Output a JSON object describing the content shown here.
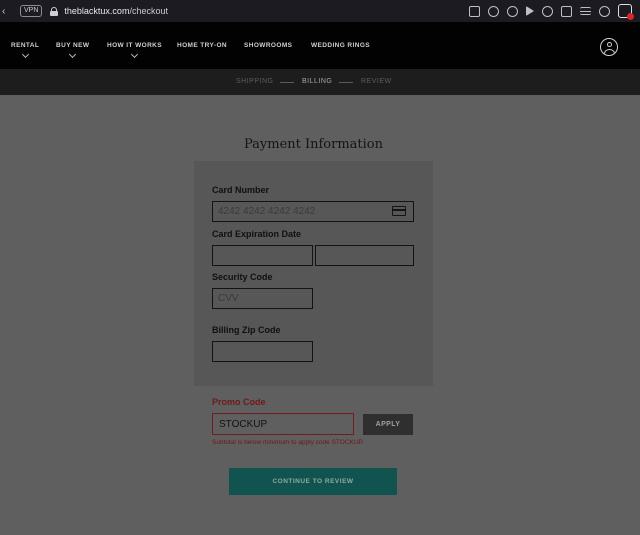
{
  "browser": {
    "back_icon": "chevron-left-icon",
    "vpn_label": "VPN",
    "url_host": "theblacktux.com",
    "url_path": "/checkout"
  },
  "nav": {
    "items": [
      "RENTAL",
      "BUY NEW",
      "HOW IT WORKS",
      "HOME TRY-ON",
      "SHOWROOMS",
      "WEDDING RINGS"
    ],
    "account_icon": "account-icon"
  },
  "steps": {
    "shipping": "SHIPPING",
    "billing": "BILLING",
    "review": "REVIEW",
    "active": "BILLING"
  },
  "form": {
    "title": "Payment Information",
    "card_number_label": "Card Number",
    "card_number_placeholder": "4242 4242 4242 4242",
    "expiration_label": "Card Expiration Date",
    "expiration_month_value": "",
    "expiration_year_value": "",
    "security_label": "Security Code",
    "security_placeholder": "CVV",
    "zip_label": "Billing Zip Code",
    "zip_value": ""
  },
  "promo": {
    "label": "Promo Code",
    "value": "STOCKUP",
    "apply_label": "APPLY",
    "error": "Subtotal is below minimum to apply code STOCKUP."
  },
  "continue_label": "CONTINUE TO REVIEW",
  "colors": {
    "overlay_bg": "#5f5f5f",
    "nav_bg": "#020202",
    "error": "#6e1818",
    "continue_bg": "#10534f"
  }
}
